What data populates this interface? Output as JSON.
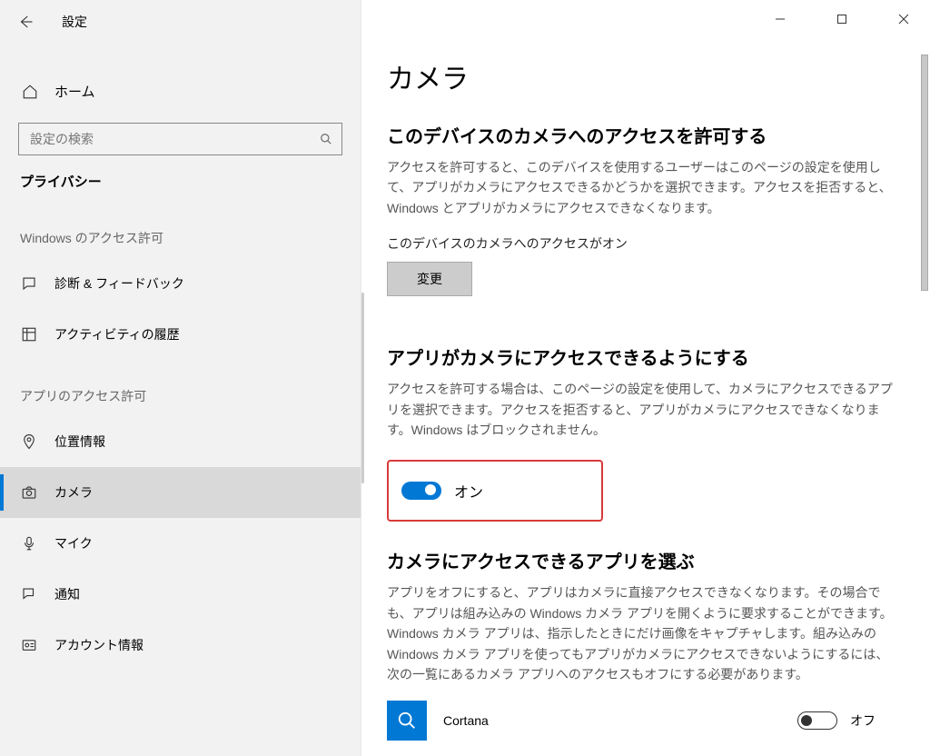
{
  "window": {
    "title": "設定"
  },
  "sidebar": {
    "home": "ホーム",
    "search_placeholder": "設定の検索",
    "category": "プライバシー",
    "group_windows": "Windows のアクセス許可",
    "group_apps": "アプリのアクセス許可",
    "items_windows": [
      {
        "label": "診断 & フィードバック"
      },
      {
        "label": "アクティビティの履歴"
      }
    ],
    "items_apps": [
      {
        "label": "位置情報"
      },
      {
        "label": "カメラ"
      },
      {
        "label": "マイク"
      },
      {
        "label": "通知"
      },
      {
        "label": "アカウント情報"
      }
    ]
  },
  "main": {
    "page_title": "カメラ",
    "section1_title": "このデバイスのカメラへのアクセスを許可する",
    "section1_desc": "アクセスを許可すると、このデバイスを使用するユーザーはこのページの設定を使用して、アプリがカメラにアクセスできるかどうかを選択できます。アクセスを拒否すると、Windows とアプリがカメラにアクセスできなくなります。",
    "section1_status": "このデバイスのカメラへのアクセスがオン",
    "change_button": "変更",
    "section2_title": "アプリがカメラにアクセスできるようにする",
    "section2_desc": "アクセスを許可する場合は、このページの設定を使用して、カメラにアクセスできるアプリを選択できます。アクセスを拒否すると、アプリがカメラにアクセスできなくなります。Windows はブロックされません。",
    "toggle_on_label": "オン",
    "section3_title": "カメラにアクセスできるアプリを選ぶ",
    "section3_desc": "アプリをオフにすると、アプリはカメラに直接アクセスできなくなります。その場合でも、アプリは組み込みの Windows カメラ アプリを開くように要求することができます。Windows カメラ アプリは、指示したときにだけ画像をキャプチャします。組み込みの Windows カメラ アプリを使ってもアプリがカメラにアクセスできないようにするには、次の一覧にあるカメラ アプリへのアクセスもオフにする必要があります。",
    "app_name": "Cortana",
    "toggle_off_label": "オフ"
  }
}
